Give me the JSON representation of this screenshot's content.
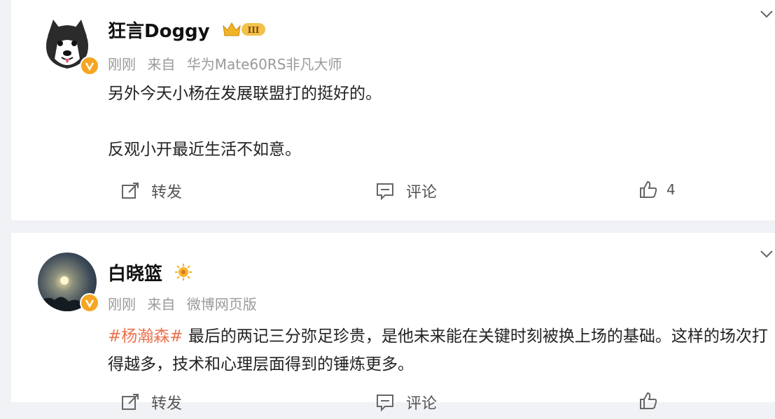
{
  "posts": [
    {
      "author": "狂言Doggy",
      "badge_text": "III",
      "meta": {
        "time": "刚刚",
        "source_prefix": "来自",
        "source": "华为Mate60RS非凡大师"
      },
      "paragraphs": [
        "另外今天小杨在发展联盟打的挺好的。",
        "反观小开最近生活不如意。"
      ],
      "actions": {
        "forward": "转发",
        "comment": "评论",
        "likes": "4"
      }
    },
    {
      "author": "白晓篮",
      "meta": {
        "time": "刚刚",
        "source_prefix": "来自",
        "source": "微博网页版"
      },
      "topic": "#杨瀚森#",
      "text": " 最后的两记三分弥足珍贵，是他未来能在关键时刻被换上场的基础。这样的场次打得越多，技术和心理层面得到的锤炼更多。",
      "actions": {
        "forward": "转发",
        "comment": "评论",
        "likes": ""
      }
    }
  ],
  "colors": {
    "topic": "#eb7350",
    "verified_badge": "#f5a623",
    "meta_gray": "#9a9a9a"
  },
  "icons": [
    "husky-avatar",
    "moon-night-avatar",
    "crown-icon",
    "verified-badge-icon",
    "share-icon",
    "comment-icon",
    "like-icon",
    "chevron-down-icon"
  ]
}
